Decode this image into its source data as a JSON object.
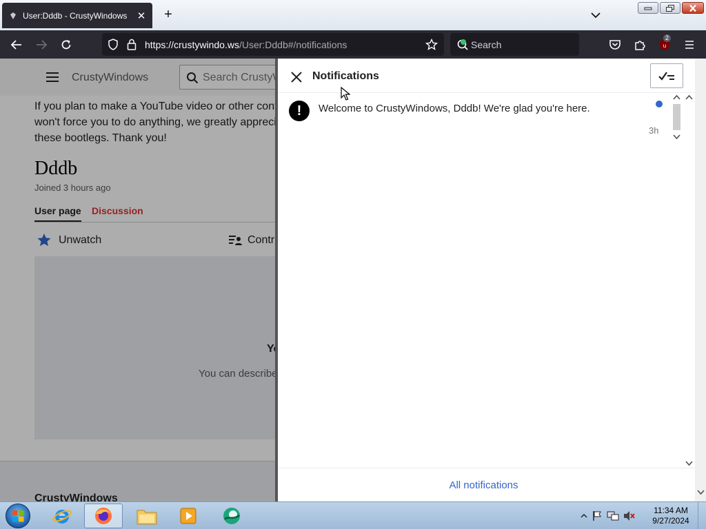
{
  "browser": {
    "tab_title": "User:Dddb - CrustyWindows",
    "tab_close": "✕",
    "new_tab": "+",
    "url_host": "https://crustywindo.ws",
    "url_path": "/User:Dddb#/notifications",
    "search_label": "Search",
    "extension_badge": "2"
  },
  "page": {
    "site_name": "CrustyWindows",
    "search_placeholder": "Search CrustyWindows",
    "notice_line1": "If you plan to make a YouTube video or other cont",
    "notice_line2": "won't force you to do anything, we greatly appreci",
    "notice_line3": "these bootlegs. Thank you!",
    "user_title": "Dddb",
    "joined": "Joined 3 hours ago",
    "tab_user_page": "User page",
    "tab_discussion": "Discussion",
    "unwatch": "Unwatch",
    "contributions": "Contri",
    "empty_title": "Yo",
    "empty_desc": "You can describe",
    "footer_site": "CrustyWindows"
  },
  "notifications": {
    "title": "Notifications",
    "items": [
      {
        "text": "Welcome to CrustyWindows, Dddb! We're glad you're here.",
        "time": "3h",
        "unread": true
      }
    ],
    "all_link": "All notifications"
  },
  "taskbar": {
    "time": "11:34 AM",
    "date": "9/27/2024"
  },
  "colors": {
    "link": "#3366cc",
    "unread_dot": "#3366cc",
    "discussion_red": "#dd3333",
    "browser_chrome": "#2b2a33"
  }
}
